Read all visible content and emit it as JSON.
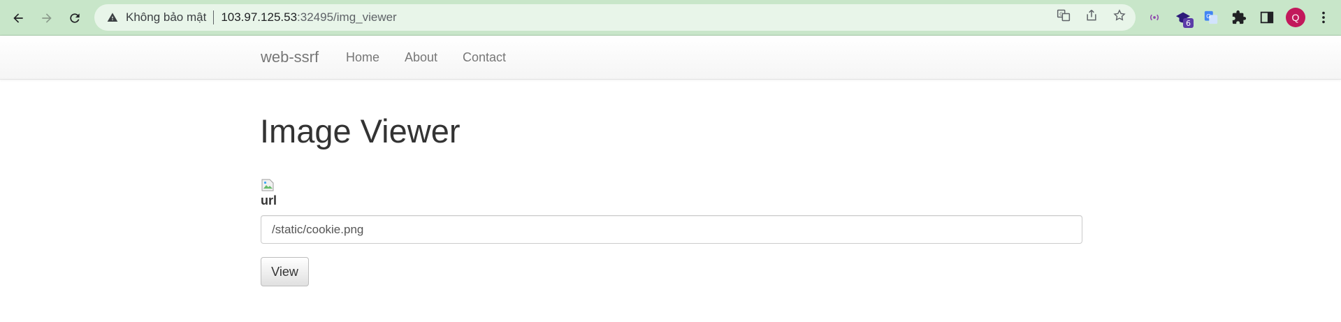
{
  "browser": {
    "security_label": "Không bảo mật",
    "url_host": "103.97.125.53",
    "url_rest": ":32495/img_viewer",
    "avatar_initial": "Q",
    "extension_badge": "6",
    "chrome_color": "#c8e6c9",
    "omnibox_color": "#e8f5e9",
    "avatar_color": "#c2185b"
  },
  "navbar": {
    "brand": "web-ssrf",
    "links": [
      "Home",
      "About",
      "Contact"
    ]
  },
  "main": {
    "title": "Image Viewer",
    "field_label": "url",
    "url_value": "/static/cookie.png",
    "submit_label": "View"
  }
}
